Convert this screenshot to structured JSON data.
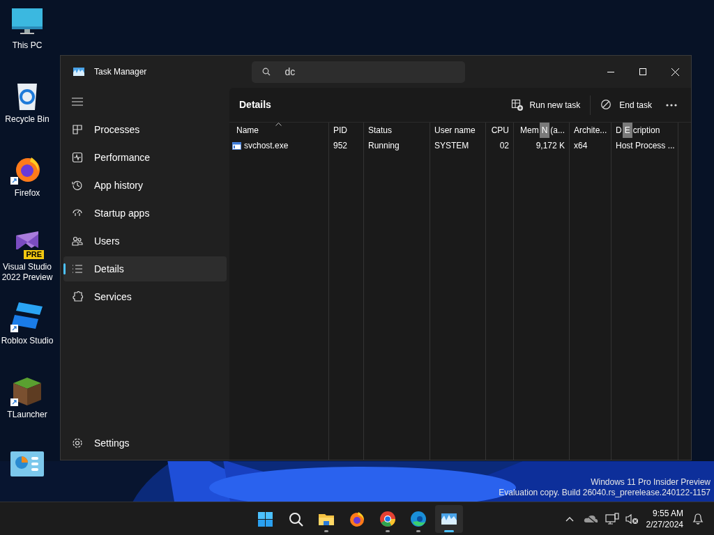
{
  "desktop_icons": [
    {
      "kind": "monitor",
      "label": "This PC"
    },
    {
      "kind": "recycle",
      "label": "Recycle Bin"
    },
    {
      "kind": "firefox",
      "label": "Firefox"
    },
    {
      "kind": "vs",
      "label": "Visual Studio 2022 Preview",
      "badge": "PRE"
    },
    {
      "kind": "roblox",
      "label": "Roblox Studio"
    },
    {
      "kind": "block",
      "label": "TLauncher"
    },
    {
      "kind": "chart"
    }
  ],
  "window": {
    "title": "Task Manager",
    "search": {
      "value": "dc"
    }
  },
  "sidebar": {
    "items": [
      {
        "kind": "processes",
        "label": "Processes",
        "selected": false
      },
      {
        "kind": "performance",
        "label": "Performance",
        "selected": false
      },
      {
        "kind": "history",
        "label": "App history",
        "selected": false
      },
      {
        "kind": "startup",
        "label": "Startup apps",
        "selected": false
      },
      {
        "kind": "users",
        "label": "Users",
        "selected": false
      },
      {
        "kind": "details",
        "label": "Details",
        "selected": true
      },
      {
        "kind": "services",
        "label": "Services",
        "selected": false
      }
    ],
    "footer": {
      "label": "Settings"
    }
  },
  "page": {
    "title": "Details",
    "actions": [
      {
        "kind": "run",
        "label": "Run new task"
      },
      {
        "kind": "end",
        "label": "End task"
      }
    ]
  },
  "table": {
    "columns": [
      {
        "label": "Name",
        "sorted": true
      },
      {
        "label": "PID"
      },
      {
        "label": "Status"
      },
      {
        "label": "User name"
      },
      {
        "label": "CPU"
      },
      {
        "label_start": "Mem",
        "keytip": "N",
        "label_end": "(a..."
      },
      {
        "label": "Archite..."
      },
      {
        "label_start": "D",
        "keytip": "E",
        "label_end": "cription"
      }
    ],
    "rows": [
      [
        "svchost.exe",
        "952",
        "Running",
        "SYSTEM",
        "02",
        "9,172 K",
        "x64",
        "Host Process ..."
      ]
    ]
  },
  "watermark": [
    "Windows 11 Pro Insider Preview",
    "Evaluation copy. Build 26040.rs_prerelease.240122-1157"
  ],
  "taskbar": {
    "apps": [
      {
        "kind": "start",
        "active": false
      },
      {
        "kind": "search",
        "active": false
      },
      {
        "kind": "folder",
        "active": false,
        "running": true
      },
      {
        "kind": "firefox",
        "active": false,
        "running": false
      },
      {
        "kind": "chrome",
        "active": false,
        "running": true
      },
      {
        "kind": "edge",
        "active": false,
        "running": true
      },
      {
        "kind": "taskmgr",
        "active": true,
        "running": true
      }
    ],
    "time": "9:55 AM",
    "date": "2/27/2024"
  }
}
